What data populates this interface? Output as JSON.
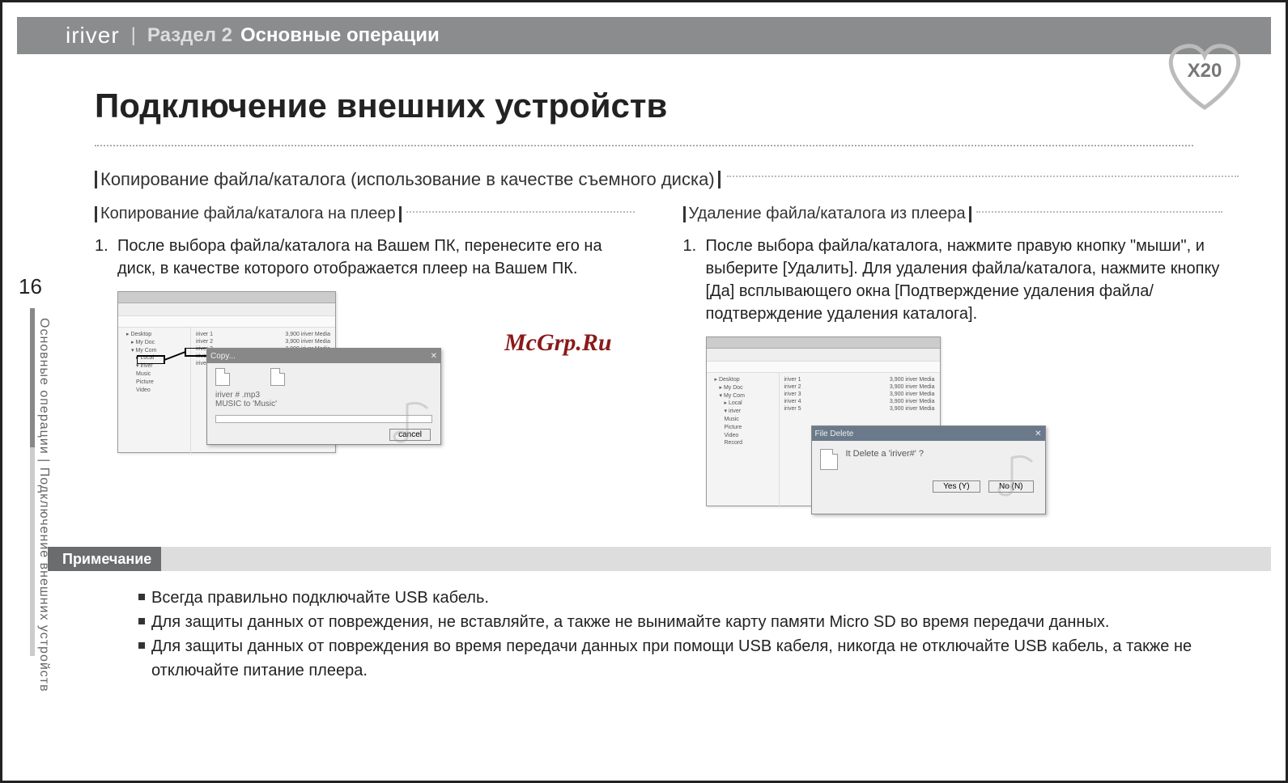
{
  "header": {
    "brand": "iriver",
    "section_label": "Раздел 2",
    "section_title": "Основные операции"
  },
  "badge": {
    "model": "X20"
  },
  "page_title": "Подключение внешних устройств",
  "page_number": "16",
  "side_text": "Основные операции | Подключение внешних устройств",
  "main_subhead": "Копирование файла/каталога (использование в качестве съемного диска)",
  "left": {
    "subhead": "Копирование файла/каталога на плеер",
    "step_num": "1.",
    "step_text": "После выбора файла/каталога на Вашем ПК, перенесите его на диск, в качестве которого отображается плеер на Вашем ПК.",
    "copy_dialog": {
      "title": "Copy...",
      "line1": "iriver # .mp3",
      "line2": "MUSIC to 'Music'",
      "cancel": "cancel"
    }
  },
  "right": {
    "subhead": "Удаление файла/каталога из плеера",
    "step_num": "1.",
    "step_text": "После выбора файла/каталога, нажмите правую кнопку \"мыши\", и выберите [Удалить]. Для удаления файла/каталога, нажмите кнопку [Да] всплывающего окна [Подтверждение удаления файла/подтверждение удаления каталога].",
    "delete_dialog": {
      "title": "File Delete",
      "msg": "It Delete a 'iriver#' ?",
      "yes": "Yes (Y)",
      "no": "No (N)"
    }
  },
  "note_label": "Примечание",
  "notes": [
    "Всегда правильно подключайте USB кабель.",
    "Для защиты данных от повреждения, не вставляйте, а также не вынимайте карту памяти Micro SD во время передачи данных.",
    "Для защиты данных от повреждения во время передачи данных при помощи USB кабеля, никогда не отключайте USB кабель, а также не отключайте питание плеера."
  ],
  "watermark": "McGrp.Ru"
}
